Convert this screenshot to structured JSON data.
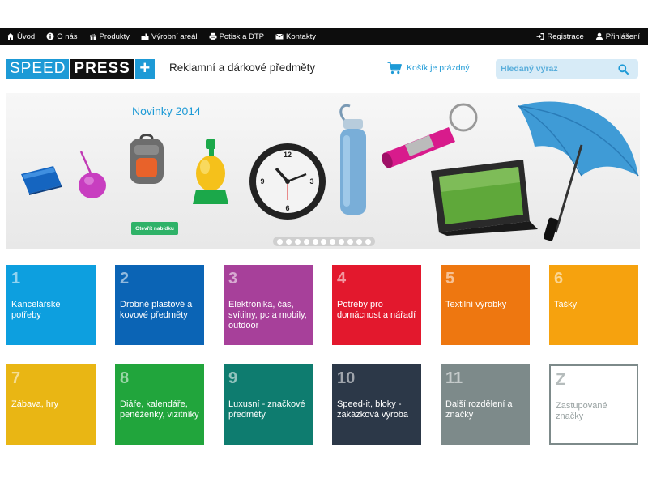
{
  "nav": {
    "left": [
      {
        "label": "Úvod",
        "icon": "home-icon"
      },
      {
        "label": "O nás",
        "icon": "info-icon"
      },
      {
        "label": "Produkty",
        "icon": "gift-icon"
      },
      {
        "label": "Výrobní areál",
        "icon": "factory-icon"
      },
      {
        "label": "Potisk a DTP",
        "icon": "print-icon"
      },
      {
        "label": "Kontakty",
        "icon": "envelope-icon"
      }
    ],
    "right": [
      {
        "label": "Registrace",
        "icon": "signin-icon"
      },
      {
        "label": "Přihlášení",
        "icon": "user-icon"
      }
    ]
  },
  "header": {
    "logo_part1": "SPEED",
    "logo_part2": "PRESS",
    "logo_plus": "+",
    "tagline": "Reklamní a dárkové předměty",
    "cart_label": "Košík je prázdný",
    "search_placeholder": "Hledaný výraz"
  },
  "banner": {
    "title": "Novinky 2014",
    "button_label": "Otevřít nabídku",
    "slide_count": 11
  },
  "categories": [
    {
      "num": "1",
      "label": "Kancelářské potřeby",
      "color": "#0d9fdf"
    },
    {
      "num": "2",
      "label": "Drobné plastové a kovové předměty",
      "color": "#0b64b5"
    },
    {
      "num": "3",
      "label": "Elektronika, čas, svítilny, pc a mobily, outdoor",
      "color": "#a7409a"
    },
    {
      "num": "4",
      "label": "Potřeby pro domácnost a nářadí",
      "color": "#e3182d"
    },
    {
      "num": "5",
      "label": "Textilní výrobky",
      "color": "#ee7710"
    },
    {
      "num": "6",
      "label": "Tašky",
      "color": "#f6a20e"
    },
    {
      "num": "7",
      "label": "Zábava, hry",
      "color": "#e9b614"
    },
    {
      "num": "8",
      "label": "Diáře, kalendáře, peněženky, vizitníky",
      "color": "#21a53c"
    },
    {
      "num": "9",
      "label": "Luxusní - značkové předměty",
      "color": "#0e7c6f"
    },
    {
      "num": "10",
      "label": "Speed-it, bloky - zakázková výroba",
      "color": "#2c3848"
    },
    {
      "num": "11",
      "label": "Další rozdělení a značky",
      "color": "#7d8a8a"
    },
    {
      "num": "Z",
      "label": "Zastupované značky",
      "color": "#ffffff"
    }
  ]
}
